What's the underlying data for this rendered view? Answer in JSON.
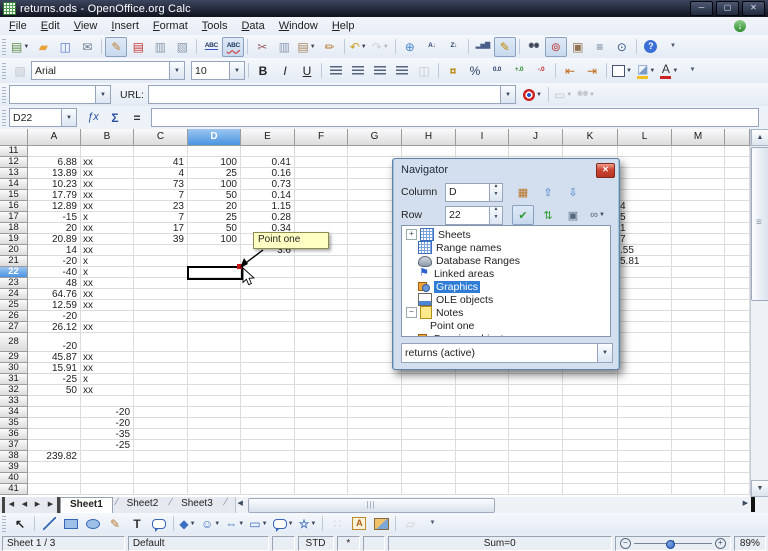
{
  "window": {
    "title": "returns.ods - OpenOffice.org Calc",
    "buttons": {
      "minimize": "─",
      "restore": "▢",
      "close": "✕"
    }
  },
  "menubar": {
    "items": [
      "File",
      "Edit",
      "View",
      "Insert",
      "Format",
      "Tools",
      "Data",
      "Window",
      "Help"
    ],
    "update_icon": "↓"
  },
  "toolbars": {
    "standard": [
      {
        "n": "new-document-icon",
        "g": "▤",
        "c": "#5d8f46",
        "drop": 1
      },
      {
        "n": "open-icon",
        "g": "▰",
        "c": "#e8a33d"
      },
      {
        "n": "save-icon",
        "g": "◫",
        "c": "#5a7ac9"
      },
      {
        "n": "email-icon",
        "g": "✉",
        "c": "#6a7a8c"
      },
      {
        "sep": 1
      },
      {
        "n": "edit-file-icon",
        "g": "✎",
        "c": "#c08030",
        "pressed": 1
      },
      {
        "n": "export-pdf-icon",
        "g": "▤",
        "c": "#c93434"
      },
      {
        "n": "print-icon",
        "g": "▥",
        "c": "#8a99ac"
      },
      {
        "n": "page-preview-icon",
        "g": "▧",
        "c": "#8a99ac"
      },
      {
        "sep": 1
      },
      {
        "n": "spelling-icon",
        "g": "ABC",
        "small": 1,
        "c": "#203860",
        "under": "#3355cc"
      },
      {
        "n": "autospellcheck-icon",
        "g": "ABC",
        "small": 1,
        "c": "#203860",
        "under": "#cc2222",
        "wavy": 1,
        "pressed": 1
      },
      {
        "sep": 1
      },
      {
        "n": "cut-icon",
        "g": "✂",
        "c": "#9a6060"
      },
      {
        "n": "copy-icon",
        "g": "▥",
        "c": "#8a9ab0"
      },
      {
        "n": "paste-icon",
        "g": "▤",
        "c": "#a8835c",
        "drop": 1
      },
      {
        "n": "format-paintbrush-icon",
        "g": "✏",
        "c": "#b5772e"
      },
      {
        "sep": 1
      },
      {
        "n": "undo-icon",
        "g": "↶",
        "c": "#c9a227",
        "drop": 1
      },
      {
        "n": "redo-icon",
        "g": "↷",
        "c": "#8a96a8",
        "drop": 1,
        "disabled": 1
      },
      {
        "sep": 1
      },
      {
        "n": "hyperlink-icon",
        "g": "⊕",
        "c": "#4488cc"
      },
      {
        "n": "sort-ascending-icon",
        "g": "A↓",
        "small": 1,
        "c": "#2c4066"
      },
      {
        "n": "sort-descending-icon",
        "g": "Z↓",
        "small": 1,
        "c": "#2c4066"
      },
      {
        "sep": 1
      },
      {
        "n": "insert-chart-icon",
        "g": "▂▅▇",
        "small": 1,
        "c": "#4a6088"
      },
      {
        "n": "draw-functions-icon",
        "g": "✎",
        "c": "#c08800",
        "pressed": 1
      },
      {
        "sep": 1
      },
      {
        "n": "find-replace-icon",
        "g": "◉◉",
        "small": 1,
        "c": "#3a4456"
      },
      {
        "n": "navigator-icon",
        "g": "⊚",
        "c": "#c04040",
        "pressed": 1
      },
      {
        "n": "gallery-icon",
        "g": "▣",
        "c": "#927452"
      },
      {
        "n": "data-sources-icon",
        "g": "≡",
        "c": "#66788c"
      },
      {
        "n": "zoom-icon",
        "g": "⊙",
        "c": "#355a86"
      },
      {
        "sep": 1
      },
      {
        "n": "help-icon",
        "g": "?",
        "circle": 1,
        "c": "#ffffff",
        "bg": "#3a6fd8"
      },
      {
        "n": "toolbar1-overflow-icon",
        "g": "▾",
        "small": 1,
        "c": "#4a5870"
      }
    ],
    "formatting_icons": [
      {
        "n": "bold-button",
        "g": "B",
        "c": "#222222",
        "bold": 1
      },
      {
        "n": "italic-button",
        "g": "I",
        "c": "#222222",
        "italic": 1
      },
      {
        "n": "underline-button",
        "g": "U",
        "c": "#222222",
        "uline": 1
      },
      {
        "sep": 1
      },
      {
        "n": "align-left-icon",
        "stripes": 1
      },
      {
        "n": "align-center-icon",
        "stripes": 1
      },
      {
        "n": "align-right-icon",
        "stripes": 1
      },
      {
        "n": "align-justified-icon",
        "stripes": 1
      },
      {
        "n": "merge-cells-icon",
        "g": "◫",
        "c": "#66788c",
        "disabled": 1
      },
      {
        "sep": 1
      },
      {
        "n": "currency-format-icon",
        "g": "¤",
        "c": "#b8860b",
        "bold": 1
      },
      {
        "n": "percent-format-icon",
        "g": "%",
        "c": "#2c4066"
      },
      {
        "n": "standard-format-icon",
        "g": "0.0",
        "small": 1,
        "c": "#2c4066"
      },
      {
        "n": "add-decimal-icon",
        "g": "+.0",
        "small": 1,
        "c": "#2a8a2a"
      },
      {
        "n": "delete-decimal-icon",
        "g": "-.0",
        "small": 1,
        "c": "#c03030"
      },
      {
        "sep": 1
      },
      {
        "n": "decrease-indent-icon",
        "g": "⇤",
        "c": "#c06a20"
      },
      {
        "n": "increase-indent-icon",
        "g": "⇥",
        "c": "#c06a20"
      },
      {
        "sep": 1
      },
      {
        "n": "borders-icon",
        "border": 1,
        "drop": 1
      },
      {
        "n": "background-color-icon",
        "g": "◪",
        "c": "#7a9cc8",
        "bar": "#f0c020",
        "drop": 1
      },
      {
        "n": "font-color-icon",
        "g": "A",
        "c": "#333333",
        "bar": "#cc2222",
        "drop": 1
      },
      {
        "n": "toolbar2-overflow-icon",
        "g": "▾",
        "small": 1,
        "c": "#4a5870"
      }
    ],
    "hyperlink_icons": [
      {
        "n": "hyperlink-target-icon",
        "circle2": 1,
        "drop": 1
      },
      {
        "sep": 1
      },
      {
        "n": "link-frame-icon",
        "g": "▭",
        "c": "#66788c",
        "drop": 1,
        "disabled": 1
      },
      {
        "n": "find-toolbar-icon",
        "g": "◉◉",
        "small": 1,
        "c": "#66788c",
        "drop": 1,
        "disabled": 1
      }
    ],
    "drawing": [
      {
        "n": "select-arrow-icon",
        "g": "↖",
        "c": "#222222",
        "bold": 1
      },
      {
        "sep": 1
      },
      {
        "n": "line-tool-icon",
        "line": 1
      },
      {
        "n": "rectangle-tool-icon",
        "rect": 1
      },
      {
        "n": "ellipse-tool-icon",
        "ellipse": 1
      },
      {
        "n": "freeform-line-icon",
        "g": "✎",
        "c": "#b5772e"
      },
      {
        "n": "text-tool-icon",
        "g": "T",
        "c": "#333333",
        "bold": 1
      },
      {
        "n": "callout-tool-icon",
        "bubble": 1
      },
      {
        "sep": 1
      },
      {
        "n": "basic-shapes-icon",
        "g": "◆",
        "c": "#3d6fc4",
        "drop": 1
      },
      {
        "n": "symbol-shapes-icon",
        "g": "☺",
        "c": "#3d6fc4",
        "drop": 1
      },
      {
        "n": "block-arrows-icon",
        "g": "⇔",
        "c": "#3d6fc4",
        "bold": 1,
        "drop": 1
      },
      {
        "n": "flowchart-icon",
        "g": "▭",
        "c": "#3d6fc4",
        "drop": 1
      },
      {
        "n": "callouts-icon",
        "bubble": 1,
        "drop": 1
      },
      {
        "n": "stars-icon",
        "g": "☆",
        "c": "#3d6fc4",
        "bold": 1,
        "drop": 1
      },
      {
        "sep": 1
      },
      {
        "n": "points-icon",
        "g": "∷",
        "c": "#8a96a8",
        "disabled": 1
      },
      {
        "n": "fontwork-gallery-icon",
        "fontwork": 1
      },
      {
        "n": "picture-from-file-icon",
        "pic": 1
      },
      {
        "sep": 1
      },
      {
        "n": "extrusion-icon",
        "g": "▱",
        "c": "#8a96a8",
        "disabled": 1
      },
      {
        "n": "drawbar-overflow-icon",
        "g": "▾",
        "small": 1,
        "c": "#4a5870"
      }
    ],
    "navigator_row1": [
      {
        "n": "data-range-icon",
        "g": "▦",
        "c": "#b87020"
      },
      {
        "n": "start-icon",
        "g": "⇧",
        "c": "#3a7cc8"
      },
      {
        "n": "end-icon",
        "g": "⇩",
        "c": "#3a7cc8"
      }
    ],
    "navigator_row2": [
      {
        "n": "contents-icon",
        "g": "✔",
        "c": "#2a9a2a",
        "pressed": 1
      },
      {
        "n": "toggle-icon",
        "g": "⇅",
        "c": "#2a9a2a"
      },
      {
        "n": "scenarios-icon",
        "g": "▣",
        "c": "#56687e"
      },
      {
        "n": "drag-mode-icon",
        "g": "∞",
        "c": "#56687e",
        "drop": 1
      }
    ]
  },
  "format_bar": {
    "font_name": "Arial",
    "font_size": "10"
  },
  "hyperlink_bar": {
    "url_label": "URL:",
    "url_value": "",
    "name_value": ""
  },
  "formula_bar": {
    "cell_ref": "D22",
    "fx_icon": "ƒx",
    "sum_icon": "Σ",
    "equals_icon": "=",
    "input_value": ""
  },
  "grid": {
    "columns": [
      "A",
      "B",
      "C",
      "D",
      "E",
      "F",
      "G",
      "H",
      "I",
      "J",
      "K",
      "L",
      "M"
    ],
    "first_row": 11,
    "last_row": 41,
    "selected_column": "D",
    "selected_row": 22,
    "cells": [
      [
        12,
        "A",
        "6.88",
        "r",
        0
      ],
      [
        12,
        "B",
        "xx",
        "l",
        1
      ],
      [
        12,
        "C",
        "41",
        "r",
        0
      ],
      [
        12,
        "D",
        "100",
        "r",
        0
      ],
      [
        12,
        "E",
        "0.41",
        "r",
        0
      ],
      [
        13,
        "A",
        "13.89",
        "r",
        0
      ],
      [
        13,
        "B",
        "xx",
        "l",
        1
      ],
      [
        13,
        "C",
        "4",
        "r",
        0
      ],
      [
        13,
        "D",
        "25",
        "r",
        0
      ],
      [
        13,
        "E",
        "0.16",
        "r",
        0
      ],
      [
        14,
        "A",
        "10.23",
        "r",
        0
      ],
      [
        14,
        "B",
        "xx",
        "l",
        1
      ],
      [
        14,
        "C",
        "73",
        "r",
        0
      ],
      [
        14,
        "D",
        "100",
        "r",
        0
      ],
      [
        14,
        "E",
        "0.73",
        "r",
        0
      ],
      [
        15,
        "A",
        "17.79",
        "r",
        0
      ],
      [
        15,
        "B",
        "xx",
        "l",
        1
      ],
      [
        15,
        "C",
        "7",
        "r",
        0
      ],
      [
        15,
        "D",
        "50",
        "r",
        0
      ],
      [
        15,
        "E",
        "0.14",
        "r",
        0
      ],
      [
        16,
        "A",
        "12.89",
        "r",
        0
      ],
      [
        16,
        "B",
        "xx",
        "l",
        1
      ],
      [
        16,
        "C",
        "23",
        "r",
        0
      ],
      [
        16,
        "D",
        "20",
        "r",
        0
      ],
      [
        16,
        "E",
        "1.15",
        "r",
        0
      ],
      [
        16,
        "L",
        "4",
        "l",
        0
      ],
      [
        17,
        "A",
        "-15",
        "r",
        0
      ],
      [
        17,
        "B",
        "x",
        "l",
        1
      ],
      [
        17,
        "C",
        "7",
        "r",
        0
      ],
      [
        17,
        "D",
        "25",
        "r",
        0
      ],
      [
        17,
        "E",
        "0.28",
        "r",
        0
      ],
      [
        17,
        "L",
        "5",
        "l",
        0
      ],
      [
        18,
        "A",
        "20",
        "r",
        0
      ],
      [
        18,
        "B",
        "xx",
        "l",
        1
      ],
      [
        18,
        "C",
        "17",
        "r",
        0
      ],
      [
        18,
        "D",
        "50",
        "r",
        0
      ],
      [
        18,
        "E",
        "0.34",
        "r",
        0
      ],
      [
        18,
        "L",
        "1",
        "l",
        0
      ],
      [
        19,
        "A",
        "20.89",
        "r",
        0
      ],
      [
        19,
        "B",
        "xx",
        "l",
        1
      ],
      [
        19,
        "C",
        "39",
        "r",
        0
      ],
      [
        19,
        "D",
        "100",
        "r",
        0
      ],
      [
        19,
        "L",
        "7",
        "l",
        0
      ],
      [
        20,
        "A",
        "14",
        "r",
        0
      ],
      [
        20,
        "B",
        "xx",
        "l",
        1
      ],
      [
        20,
        "E",
        "3.6",
        "r",
        0
      ],
      [
        20,
        "L",
        ".55",
        "l",
        0
      ],
      [
        21,
        "A",
        "-20",
        "r",
        0
      ],
      [
        21,
        "B",
        "x",
        "l",
        1
      ],
      [
        21,
        "L",
        "5.81",
        "l",
        0
      ],
      [
        22,
        "A",
        "-40",
        "r",
        0
      ],
      [
        22,
        "B",
        "x",
        "l",
        1
      ],
      [
        23,
        "A",
        "48",
        "r",
        0
      ],
      [
        23,
        "B",
        "xx",
        "l",
        1
      ],
      [
        24,
        "A",
        "64.76",
        "r",
        0
      ],
      [
        24,
        "B",
        "xx",
        "l",
        1
      ],
      [
        25,
        "A",
        "12.59",
        "r",
        0
      ],
      [
        25,
        "B",
        "xx",
        "l",
        1
      ],
      [
        26,
        "A",
        "-20",
        "r",
        0
      ],
      [
        27,
        "A",
        "26.12",
        "r",
        0
      ],
      [
        27,
        "B",
        "xx",
        "l",
        1
      ],
      [
        28,
        "A",
        "-20",
        "r",
        0
      ],
      [
        29,
        "A",
        "45.87",
        "r",
        0
      ],
      [
        29,
        "B",
        "xx",
        "l",
        1
      ],
      [
        30,
        "A",
        "15.91",
        "r",
        0
      ],
      [
        30,
        "B",
        "xx",
        "l",
        1
      ],
      [
        31,
        "A",
        "-25",
        "r",
        0
      ],
      [
        31,
        "B",
        "x",
        "l",
        1
      ],
      [
        32,
        "A",
        "50",
        "r",
        0
      ],
      [
        32,
        "B",
        "xx",
        "l",
        1
      ],
      [
        34,
        "B",
        "-20",
        "r",
        0
      ],
      [
        35,
        "B",
        "-20",
        "r",
        0
      ],
      [
        36,
        "B",
        "-35",
        "r",
        0
      ],
      [
        37,
        "B",
        "-25",
        "r",
        0
      ],
      [
        38,
        "A",
        "239.82",
        "r",
        0
      ]
    ]
  },
  "note": {
    "text": "Point one"
  },
  "navigator": {
    "title": "Navigator",
    "close_glyph": "✕",
    "column_label": "Column",
    "column_value": "D",
    "row_label": "Row",
    "row_value": "22",
    "tree": [
      {
        "label": "Sheets",
        "icon": "sheets-icon",
        "cls": "ti-grid",
        "expand": "+"
      },
      {
        "label": "Range names",
        "icon": "range-names-icon",
        "cls": "ti-grid"
      },
      {
        "label": "Database Ranges",
        "icon": "database-ranges-icon",
        "cls": "ti-db"
      },
      {
        "label": "Linked areas",
        "icon": "linked-areas-icon",
        "cls": "ti-flag",
        "glyph": "⚑"
      },
      {
        "label": "Graphics",
        "icon": "graphics-icon",
        "cls": "ti-shapes",
        "selected": true
      },
      {
        "label": "OLE objects",
        "icon": "ole-objects-icon",
        "cls": "ti-ole"
      },
      {
        "label": "Notes",
        "icon": "notes-icon",
        "cls": "ti-note",
        "expand": "−"
      },
      {
        "label": "Point one",
        "indent": true
      },
      {
        "label": "Drawing objects",
        "icon": "drawing-objects-icon",
        "cls": "ti-shapes"
      }
    ],
    "doc_combo": "returns (active)"
  },
  "sheet_tabs": {
    "nav": [
      "◀",
      "◀",
      "▶",
      "▶"
    ],
    "items": [
      {
        "label": "Sheet1",
        "active": true
      },
      {
        "label": "Sheet2",
        "active": false
      },
      {
        "label": "Sheet3",
        "active": false
      }
    ]
  },
  "status": {
    "sheet": "Sheet 1 / 3",
    "page_style": "Default",
    "insert_mode": "",
    "selection_mode": "STD",
    "modified": "*",
    "signature": "",
    "sum": "Sum=0",
    "zoom": "89%"
  }
}
